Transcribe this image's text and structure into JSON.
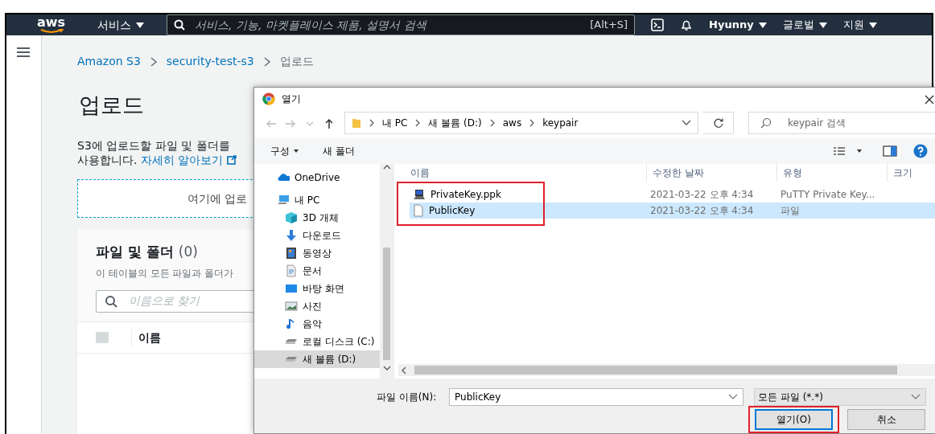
{
  "top_nav": {
    "logo": "aws",
    "services_menu": "서비스",
    "search": {
      "placeholder": "서비스, 기능, 마켓플레이스 제품, 설명서 검색",
      "shortcut": "[Alt+S]"
    },
    "user_menu": "Hyunny",
    "region_menu": "글로벌",
    "support_menu": "지원"
  },
  "breadcrumb": [
    {
      "label": "Amazon S3",
      "link": true
    },
    {
      "label": "security-test-s3",
      "link": true
    },
    {
      "label": "업로드",
      "link": false
    }
  ],
  "page_title": "업로드",
  "description": {
    "line_1": "S3에 업로드할 파일 및 폴더를",
    "line_2": "사용합니다.",
    "link": "자세히 알아보기"
  },
  "drop_zone": "여기에 업로",
  "files_panel": {
    "title": "파일 및 폴더",
    "count": "(0)",
    "subtitle": "이 테이블의 모든 파일과 폴더가",
    "search": {
      "placeholder": "이름으로 찾기"
    },
    "select_all": {
      "checked": false
    },
    "columns": [
      "이름"
    ]
  },
  "dialog": {
    "title": "열기",
    "path": [
      "내 PC",
      "새 볼륨 (D:)",
      "aws",
      "keypair"
    ],
    "search": {
      "placeholder": "keypair 검색"
    },
    "toolbar": {
      "organize": "구성",
      "new_folder": "새 폴더"
    },
    "nav_items": [
      {
        "label": "OneDrive",
        "selected": false
      },
      {
        "label": "내 PC",
        "selected": false,
        "children": [
          {
            "label": "3D 개체",
            "selected": false
          },
          {
            "label": "다운로드",
            "selected": false
          },
          {
            "label": "동영상",
            "selected": false
          },
          {
            "label": "문서",
            "selected": false
          },
          {
            "label": "바탕 화면",
            "selected": false
          },
          {
            "label": "사진",
            "selected": false
          },
          {
            "label": "음악",
            "selected": false
          },
          {
            "label": "로컬 디스크 (C:)",
            "selected": false
          },
          {
            "label": "새 볼륨 (D:)",
            "selected": true
          }
        ]
      }
    ],
    "columns": [
      "이름",
      "수정한 날짜",
      "유형",
      "크기"
    ],
    "files": [
      {
        "name": "PrivateKey.ppk",
        "kind": "putty",
        "modified": "2021-03-22 오후 4:34",
        "type": "PuTTY Private Key...",
        "selected": false
      },
      {
        "name": "PublicKey",
        "kind": "file",
        "modified": "2021-03-22 오후 4:34",
        "type": "파일",
        "selected": true
      }
    ],
    "files_highlighted": true,
    "file_name_label": "파일 이름(N):",
    "file_name": "PublicKey",
    "file_type": "모든 파일 (*.*)",
    "buttons": [
      {
        "label": "열기(O)",
        "kind": "primary",
        "highlighted": true
      },
      {
        "label": "취소",
        "kind": "secondary",
        "highlighted": false
      }
    ]
  }
}
